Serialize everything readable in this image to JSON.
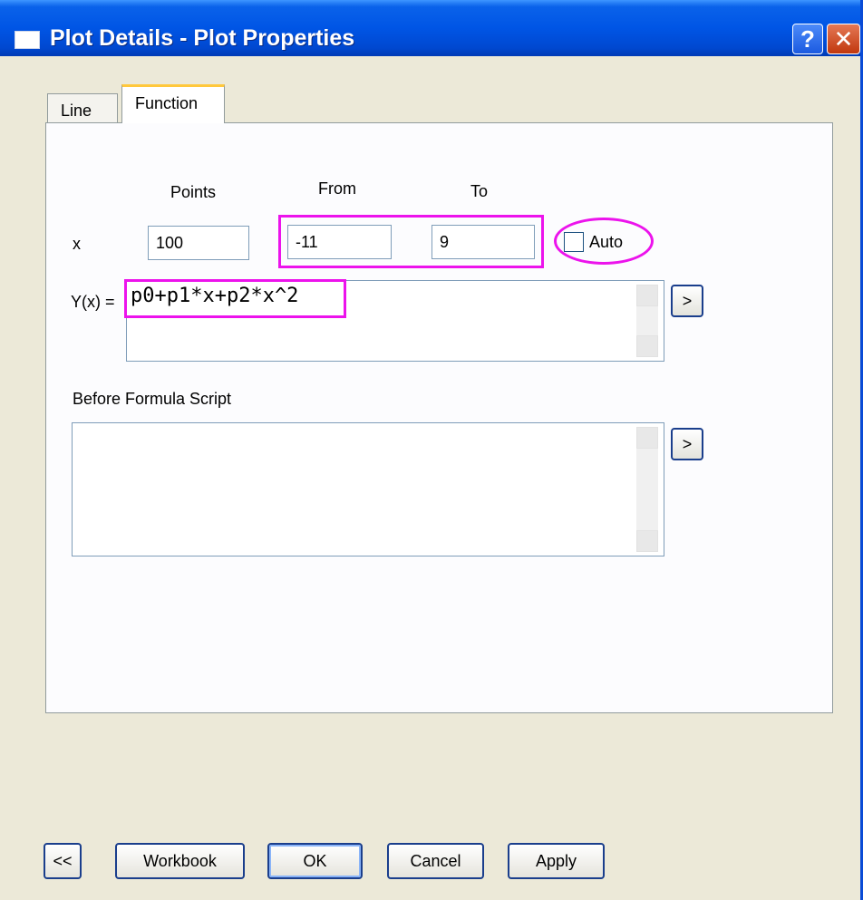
{
  "window": {
    "title": "Plot Details - Plot Properties",
    "help_label": "?",
    "close_label": "✕"
  },
  "tabs": [
    {
      "label": "Line",
      "active": false
    },
    {
      "label": "Function",
      "active": true
    }
  ],
  "function": {
    "points_label": "Points",
    "from_label": "From",
    "to_label": "To",
    "x_label": "x",
    "points_value": "100",
    "from_value": "-11",
    "to_value": "9",
    "auto_label": "Auto",
    "auto_checked": false,
    "yx_label": "Y(x) =",
    "formula": "p0+p1*x+p2*x^2",
    "expand_label": ">",
    "before_script_label": "Before Formula Script",
    "before_script_value": ""
  },
  "buttons": {
    "collapse": "<<",
    "workbook": "Workbook",
    "ok": "OK",
    "cancel": "Cancel",
    "apply": "Apply"
  },
  "colors": {
    "titlebar": "#0055E5",
    "highlight": "#EC13EC",
    "dialog_bg": "#ECE9D8"
  }
}
